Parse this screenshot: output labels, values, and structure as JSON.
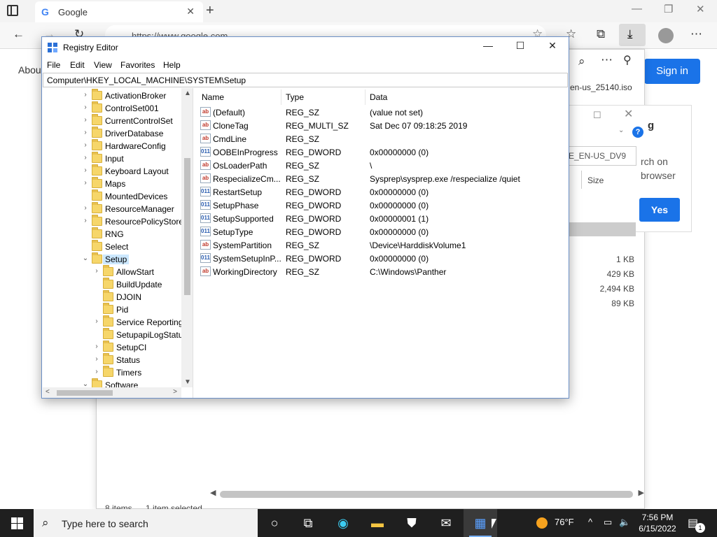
{
  "browser": {
    "tab_title": "Google",
    "url": "https://www.google.com",
    "page_about": "About",
    "sign_in": "Sign in"
  },
  "downloads": {
    "file_name": "en-us_25140.iso",
    "dialog_heading": "g",
    "field_value": "E_EN-US_DV9",
    "text_line1": "rch on",
    "text_line2": "browser",
    "yes_label": "Yes",
    "size_header": "Size",
    "sizes": [
      "1 KB",
      "429 KB",
      "2,494 KB",
      "89 KB"
    ],
    "status_items": "8 items",
    "status_selected": "1 item selected"
  },
  "regedit": {
    "title": "Registry Editor",
    "menu": [
      "File",
      "Edit",
      "View",
      "Favorites",
      "Help"
    ],
    "path": "Computer\\HKEY_LOCAL_MACHINE\\SYSTEM\\Setup",
    "tree": [
      {
        "label": "ActivationBroker",
        "level": 0,
        "expandable": true
      },
      {
        "label": "ControlSet001",
        "level": 0,
        "expandable": true
      },
      {
        "label": "CurrentControlSet",
        "level": 0,
        "expandable": true
      },
      {
        "label": "DriverDatabase",
        "level": 0,
        "expandable": true
      },
      {
        "label": "HardwareConfig",
        "level": 0,
        "expandable": true
      },
      {
        "label": "Input",
        "level": 0,
        "expandable": true
      },
      {
        "label": "Keyboard Layout",
        "level": 0,
        "expandable": true
      },
      {
        "label": "Maps",
        "level": 0,
        "expandable": true
      },
      {
        "label": "MountedDevices",
        "level": 0,
        "expandable": false
      },
      {
        "label": "ResourceManager",
        "level": 0,
        "expandable": true
      },
      {
        "label": "ResourcePolicyStore",
        "level": 0,
        "expandable": true
      },
      {
        "label": "RNG",
        "level": 0,
        "expandable": false
      },
      {
        "label": "Select",
        "level": 0,
        "expandable": false
      },
      {
        "label": "Setup",
        "level": 0,
        "expandable": true,
        "expanded": true,
        "selected": true
      },
      {
        "label": "AllowStart",
        "level": 1,
        "expandable": true
      },
      {
        "label": "BuildUpdate",
        "level": 1,
        "expandable": false
      },
      {
        "label": "DJOIN",
        "level": 1,
        "expandable": false
      },
      {
        "label": "Pid",
        "level": 1,
        "expandable": false
      },
      {
        "label": "Service Reporting",
        "level": 1,
        "expandable": true
      },
      {
        "label": "SetupapiLogStatu",
        "level": 1,
        "expandable": false
      },
      {
        "label": "SetupCI",
        "level": 1,
        "expandable": true
      },
      {
        "label": "Status",
        "level": 1,
        "expandable": true
      },
      {
        "label": "Timers",
        "level": 1,
        "expandable": true
      },
      {
        "label": "Software",
        "level": 0,
        "expandable": true,
        "expanded": true
      }
    ],
    "columns": [
      "Name",
      "Type",
      "Data"
    ],
    "values": [
      {
        "name": "(Default)",
        "type": "REG_SZ",
        "data": "(value not set)",
        "icon": "string-value-icon"
      },
      {
        "name": "CloneTag",
        "type": "REG_MULTI_SZ",
        "data": "Sat Dec 07 09:18:25 2019",
        "icon": "string-value-icon"
      },
      {
        "name": "CmdLine",
        "type": "REG_SZ",
        "data": "",
        "icon": "string-value-icon"
      },
      {
        "name": "OOBEInProgress",
        "type": "REG_DWORD",
        "data": "0x00000000 (0)",
        "icon": "binary-value-icon"
      },
      {
        "name": "OsLoaderPath",
        "type": "REG_SZ",
        "data": "\\",
        "icon": "string-value-icon"
      },
      {
        "name": "RespecializeCm...",
        "type": "REG_SZ",
        "data": "Sysprep\\sysprep.exe /respecialize /quiet",
        "icon": "string-value-icon"
      },
      {
        "name": "RestartSetup",
        "type": "REG_DWORD",
        "data": "0x00000000 (0)",
        "icon": "binary-value-icon"
      },
      {
        "name": "SetupPhase",
        "type": "REG_DWORD",
        "data": "0x00000000 (0)",
        "icon": "binary-value-icon"
      },
      {
        "name": "SetupSupported",
        "type": "REG_DWORD",
        "data": "0x00000001 (1)",
        "icon": "binary-value-icon"
      },
      {
        "name": "SetupType",
        "type": "REG_DWORD",
        "data": "0x00000000 (0)",
        "icon": "binary-value-icon"
      },
      {
        "name": "SystemPartition",
        "type": "REG_SZ",
        "data": "\\Device\\HarddiskVolume1",
        "icon": "string-value-icon"
      },
      {
        "name": "SystemSetupInP...",
        "type": "REG_DWORD",
        "data": "0x00000000 (0)",
        "icon": "binary-value-icon"
      },
      {
        "name": "WorkingDirectory",
        "type": "REG_SZ",
        "data": "C:\\Windows\\Panther",
        "icon": "string-value-icon"
      }
    ]
  },
  "taskbar": {
    "search_placeholder": "Type here to search",
    "temperature": "76°F",
    "time": "7:56 PM",
    "date": "6/15/2022",
    "notification_count": "1"
  }
}
